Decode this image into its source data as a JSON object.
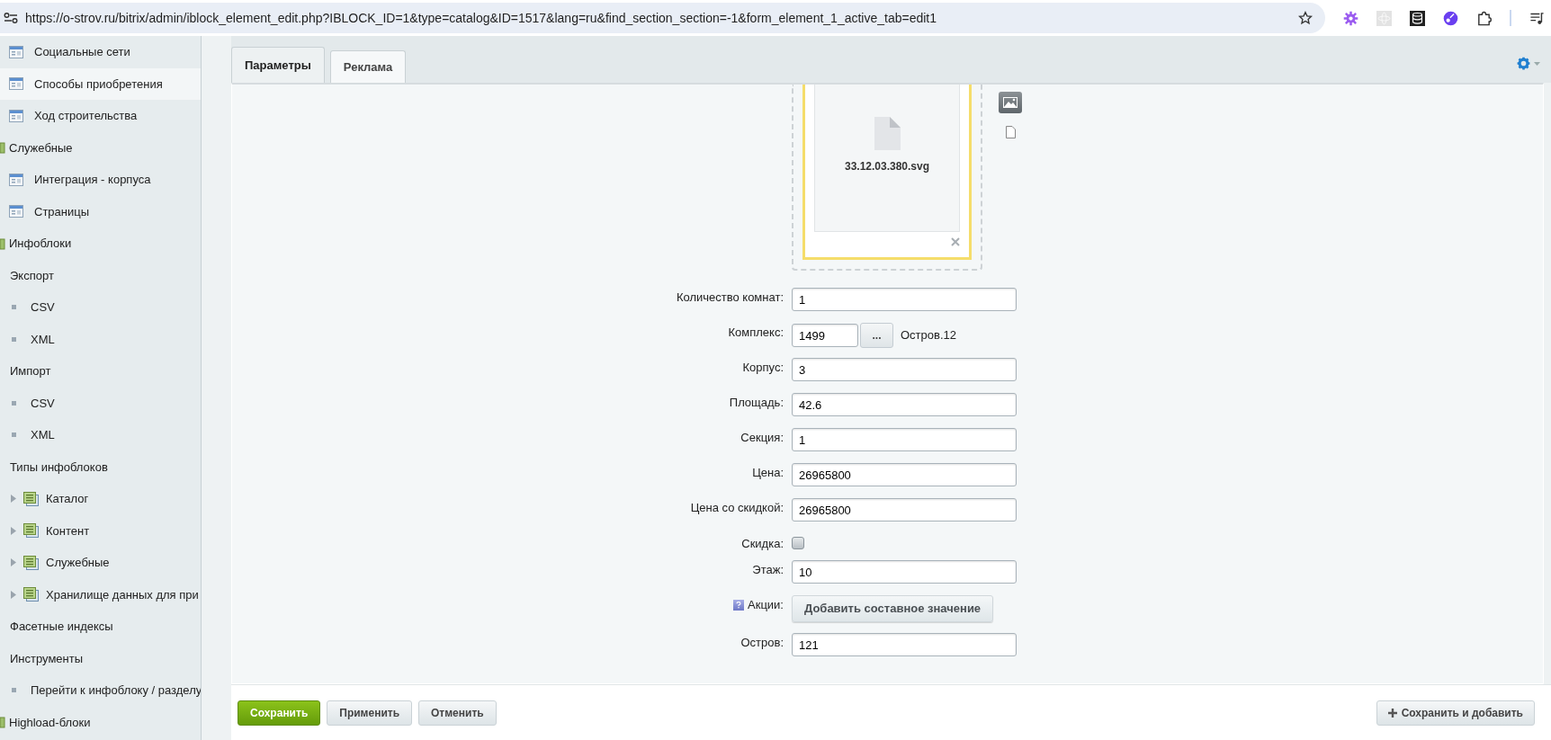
{
  "browser": {
    "url": "https://o-strov.ru/bitrix/admin/iblock_element_edit.php?IBLOCK_ID=1&type=catalog&ID=1517&lang=ru&find_section_section=-1&form_element_1_active_tab=edit1"
  },
  "sidebar": {
    "items": [
      {
        "kind": "page",
        "label": "Социальные сети",
        "selected": false
      },
      {
        "kind": "page",
        "label": "Способы приобретения",
        "selected": true
      },
      {
        "kind": "page",
        "label": "Ход строительства",
        "selected": false
      },
      {
        "kind": "group",
        "label": "Служебные",
        "selected": false
      },
      {
        "kind": "page",
        "label": "Интеграция - корпуса",
        "selected": false
      },
      {
        "kind": "page",
        "label": "Страницы",
        "selected": false
      },
      {
        "kind": "group",
        "label": "Инфоблоки",
        "selected": false
      },
      {
        "kind": "heading",
        "label": "Экспорт",
        "selected": false
      },
      {
        "kind": "bullet",
        "label": "CSV",
        "selected": false
      },
      {
        "kind": "bullet",
        "label": "XML",
        "selected": false
      },
      {
        "kind": "heading",
        "label": "Импорт",
        "selected": false
      },
      {
        "kind": "bullet",
        "label": "CSV",
        "selected": false
      },
      {
        "kind": "bullet",
        "label": "XML",
        "selected": false
      },
      {
        "kind": "heading",
        "label": "Типы инфоблоков",
        "selected": false
      },
      {
        "kind": "tree",
        "label": "Каталог",
        "selected": false
      },
      {
        "kind": "tree",
        "label": "Контент",
        "selected": false
      },
      {
        "kind": "tree",
        "label": "Служебные",
        "selected": false
      },
      {
        "kind": "tree",
        "label": "Хранилище данных для при",
        "selected": false
      },
      {
        "kind": "heading",
        "label": "Фасетные индексы",
        "selected": false
      },
      {
        "kind": "heading",
        "label": "Инструменты",
        "selected": false
      },
      {
        "kind": "bullet",
        "label": "Перейти к инфоблоку / разделу",
        "selected": false
      },
      {
        "kind": "group",
        "label": "Highload-блоки",
        "selected": false
      }
    ]
  },
  "tabs": [
    {
      "label": "Параметры",
      "selected": true
    },
    {
      "label": "Реклама",
      "selected": false
    }
  ],
  "upload": {
    "file_name": "33.12.03.380.svg"
  },
  "fields": [
    {
      "kind": "input",
      "label": "Количество комнат:",
      "value": "1"
    },
    {
      "kind": "lookup",
      "label": "Комплекс:",
      "value": "1499",
      "button": "...",
      "note": "Остров.12"
    },
    {
      "kind": "input",
      "label": "Корпус:",
      "value": "3"
    },
    {
      "kind": "input",
      "label": "Площадь:",
      "value": "42.6"
    },
    {
      "kind": "input",
      "label": "Секция:",
      "value": "1"
    },
    {
      "kind": "input",
      "label": "Цена:",
      "value": "26965800"
    },
    {
      "kind": "input",
      "label": "Цена со скидкой:",
      "value": "26965800"
    },
    {
      "kind": "checkbox",
      "label": "Скидка:",
      "checked": false
    },
    {
      "kind": "input",
      "label": "Этаж:",
      "value": "10"
    },
    {
      "kind": "button",
      "label": "Акции:",
      "button": "Добавить составное значение",
      "help": true
    },
    {
      "kind": "input",
      "label": "Остров:",
      "value": "121"
    }
  ],
  "footer": {
    "save": "Сохранить",
    "apply": "Применить",
    "cancel": "Отменить",
    "save_add": "Сохранить и добавить"
  }
}
